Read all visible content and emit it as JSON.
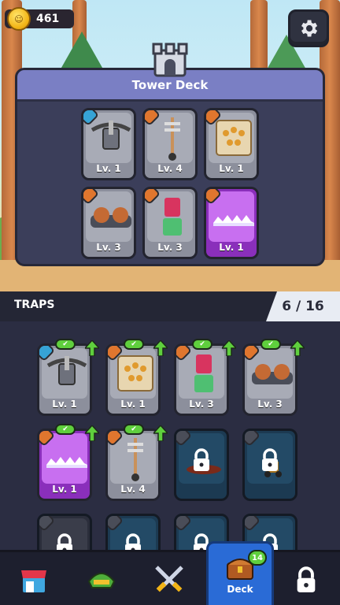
{
  "currency": {
    "coins": "461"
  },
  "tower_deck": {
    "title": "Tower Deck",
    "cards": [
      {
        "name": "crossbow-trap",
        "level": "Lv. 1",
        "rarity": "common",
        "badge": "blue"
      },
      {
        "name": "spring-spear-trap",
        "level": "Lv. 4",
        "rarity": "common",
        "badge": "orange"
      },
      {
        "name": "spike-plate-trap",
        "level": "Lv. 1",
        "rarity": "common",
        "badge": "orange"
      },
      {
        "name": "twin-cannon-trap",
        "level": "Lv. 3",
        "rarity": "common",
        "badge": "orange"
      },
      {
        "name": "piston-trap",
        "level": "Lv. 3",
        "rarity": "common",
        "badge": "orange"
      },
      {
        "name": "saw-blade-trap",
        "level": "Lv. 1",
        "rarity": "epic",
        "badge": "orange"
      }
    ]
  },
  "traps": {
    "title": "TRAPS",
    "count": "6 / 16",
    "cards": [
      {
        "name": "crossbow-trap",
        "level": "Lv. 1",
        "rarity": "common",
        "badge": "blue",
        "upgradable": true,
        "in_deck": true
      },
      {
        "name": "spike-plate-trap",
        "level": "Lv. 1",
        "rarity": "common",
        "badge": "orange",
        "upgradable": true,
        "in_deck": true
      },
      {
        "name": "piston-trap",
        "level": "Lv. 3",
        "rarity": "common",
        "badge": "orange",
        "upgradable": true,
        "in_deck": true
      },
      {
        "name": "twin-cannon-trap",
        "level": "Lv. 3",
        "rarity": "common",
        "badge": "orange",
        "upgradable": true,
        "in_deck": true
      },
      {
        "name": "saw-blade-trap",
        "level": "Lv. 1",
        "rarity": "epic",
        "badge": "orange",
        "upgradable": true,
        "in_deck": true
      },
      {
        "name": "spring-spear-trap",
        "level": "Lv. 4",
        "rarity": "common",
        "badge": "orange",
        "upgradable": true,
        "in_deck": true
      },
      {
        "name": "locked-spinner-trap",
        "locked": true
      },
      {
        "name": "locked-cannon-trap",
        "locked": true
      },
      {
        "name": "locked-trap-9",
        "locked": true
      },
      {
        "name": "locked-trap-10",
        "locked": true
      },
      {
        "name": "locked-trap-11",
        "locked": true
      },
      {
        "name": "locked-trap-12",
        "locked": true
      }
    ]
  },
  "nav": {
    "items": [
      {
        "name": "shop",
        "label": ""
      },
      {
        "name": "heroes",
        "label": ""
      },
      {
        "name": "battle",
        "label": ""
      },
      {
        "name": "deck",
        "label": "Deck",
        "badge": "14",
        "active": true
      },
      {
        "name": "locked",
        "label": ""
      }
    ]
  },
  "colors": {
    "panel_header": "#7a7fc4",
    "epic": "#8a2fbb",
    "deck_active": "#2a6bd6",
    "upgrade_green": "#5fcf3d"
  }
}
